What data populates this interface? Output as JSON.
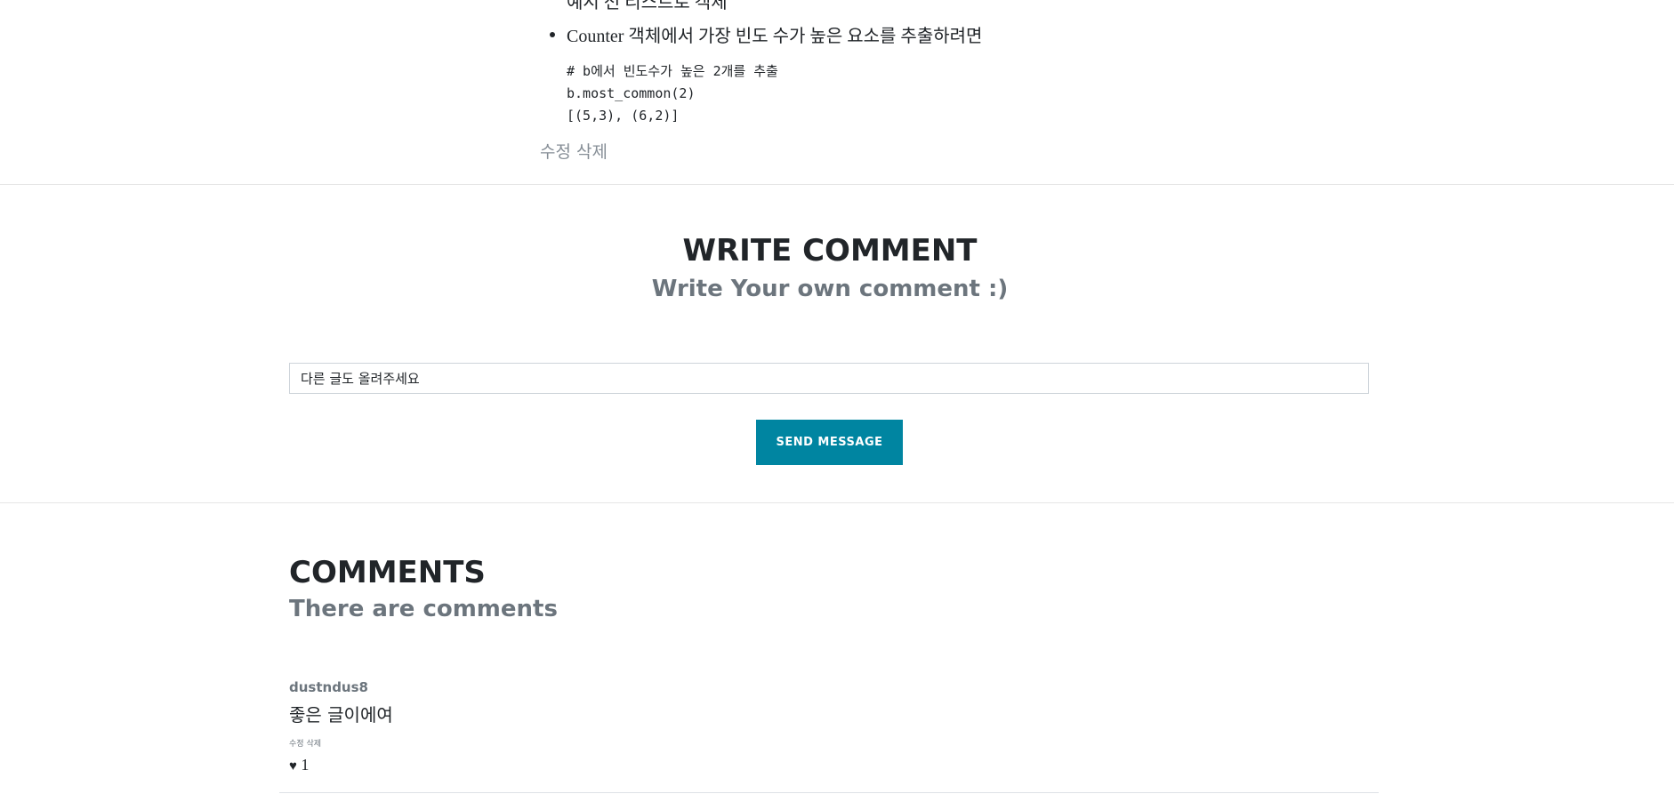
{
  "post": {
    "cut_line": "예시 전 리스트로 객체",
    "bullet": "Counter 객체에서 가장 빈도 수가 높은 요소를 추출하려면",
    "code_lines": [
      "# b에서 빈도수가 높은 2개를 추출",
      "b.most_common(2)",
      "[(5,3), (6,2)]"
    ],
    "actions": {
      "edit": "수정",
      "delete": "삭제"
    }
  },
  "write_comment": {
    "title": "WRITE COMMENT",
    "subtitle": "Write Your own comment :)",
    "input_value": "다른 글도 올려주세요",
    "send_label": "SEND MESSAGE",
    "accent_color": "#0085a1"
  },
  "comments": {
    "title": "COMMENTS",
    "subtitle": "There are comments",
    "items": [
      {
        "author": "dustndus8",
        "text": "좋은 글이에여",
        "edit": "수정",
        "delete": "삭제",
        "heart_icon": "heart-icon",
        "likes": "1"
      }
    ]
  }
}
